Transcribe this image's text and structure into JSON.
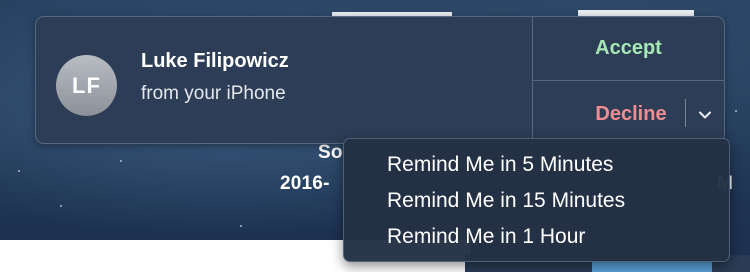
{
  "background": {
    "partial_text_1": "So",
    "partial_text_2": "2016-",
    "partial_text_3": "M"
  },
  "notification": {
    "avatar_initials": "LF",
    "caller_name": "Luke Filipowicz",
    "caller_source": "from your iPhone",
    "accept_label": "Accept",
    "decline_label": "Decline",
    "options_icon": "chevron-down-icon"
  },
  "remind_menu": {
    "items": [
      {
        "label": "Remind Me in 5 Minutes"
      },
      {
        "label": "Remind Me in 15 Minutes"
      },
      {
        "label": "Remind Me in 1 Hour"
      }
    ]
  },
  "colors": {
    "accept": "#a6e8b5",
    "decline": "#ef8e92",
    "banner_bg": "#2d3d56"
  }
}
